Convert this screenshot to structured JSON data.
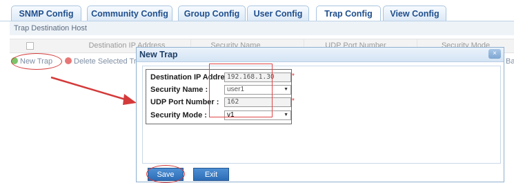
{
  "tabs": [
    {
      "label": "SNMP Config"
    },
    {
      "label": "Community Config"
    },
    {
      "label": "Group Config"
    },
    {
      "label": "User Config"
    },
    {
      "label": "Trap Config",
      "active": true
    },
    {
      "label": "View Config"
    }
  ],
  "section_title": "Trap Destination Host",
  "table": {
    "columns": [
      "Destination IP Address",
      "Security Name",
      "UDP Port Number",
      "Security Mode"
    ]
  },
  "toolbar": {
    "new_trap": "New Trap",
    "delete_selected": "Delete Selected Trap",
    "right_cut_text": "Ba"
  },
  "dialog": {
    "title": "New Trap",
    "close_label": "×",
    "fields": {
      "dest_ip": {
        "label": "Destination IP Address :",
        "value": "192.168.1.30",
        "required": "*"
      },
      "security_name": {
        "label": "Security Name :",
        "value": "user1"
      },
      "udp_port": {
        "label": "UDP Port Number :",
        "value": "162",
        "required": "*"
      },
      "security_mode": {
        "label": "Security Mode :",
        "value": "v1"
      }
    },
    "save_label": "Save",
    "exit_label": "Exit"
  },
  "colors": {
    "accent": "#2c6cb6",
    "annotation_red": "#d43a3a",
    "tab_text": "#1f4e8c"
  }
}
